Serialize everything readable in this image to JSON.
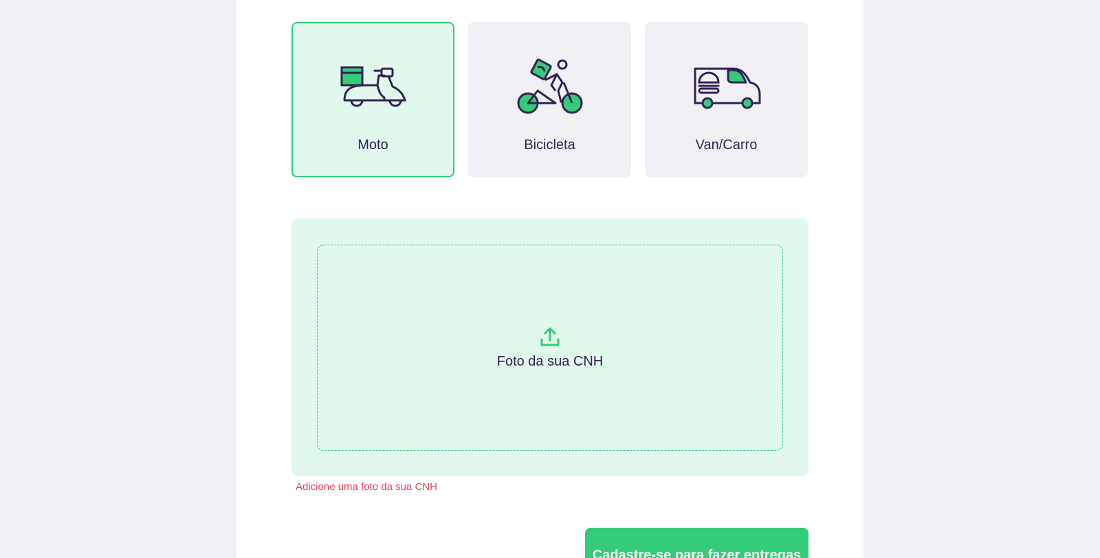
{
  "vehicles": [
    {
      "label": "Moto",
      "icon": "scooter-delivery-icon",
      "selected": true
    },
    {
      "label": "Bicicleta",
      "icon": "bicycle-courier-icon",
      "selected": false
    },
    {
      "label": "Van/Carro",
      "icon": "delivery-van-icon",
      "selected": false
    }
  ],
  "upload": {
    "icon": "upload-icon",
    "label": "Foto da sua CNH",
    "error": "Adicione uma foto da sua CNH"
  },
  "submit_label": "Cadastre-se para fazer entregas",
  "colors": {
    "accent_green": "#34cb79",
    "light_green": "#e1f8ec",
    "dark_purple": "#322153",
    "error_pink": "#e83f5b",
    "page_bg": "#f0f0f5"
  }
}
